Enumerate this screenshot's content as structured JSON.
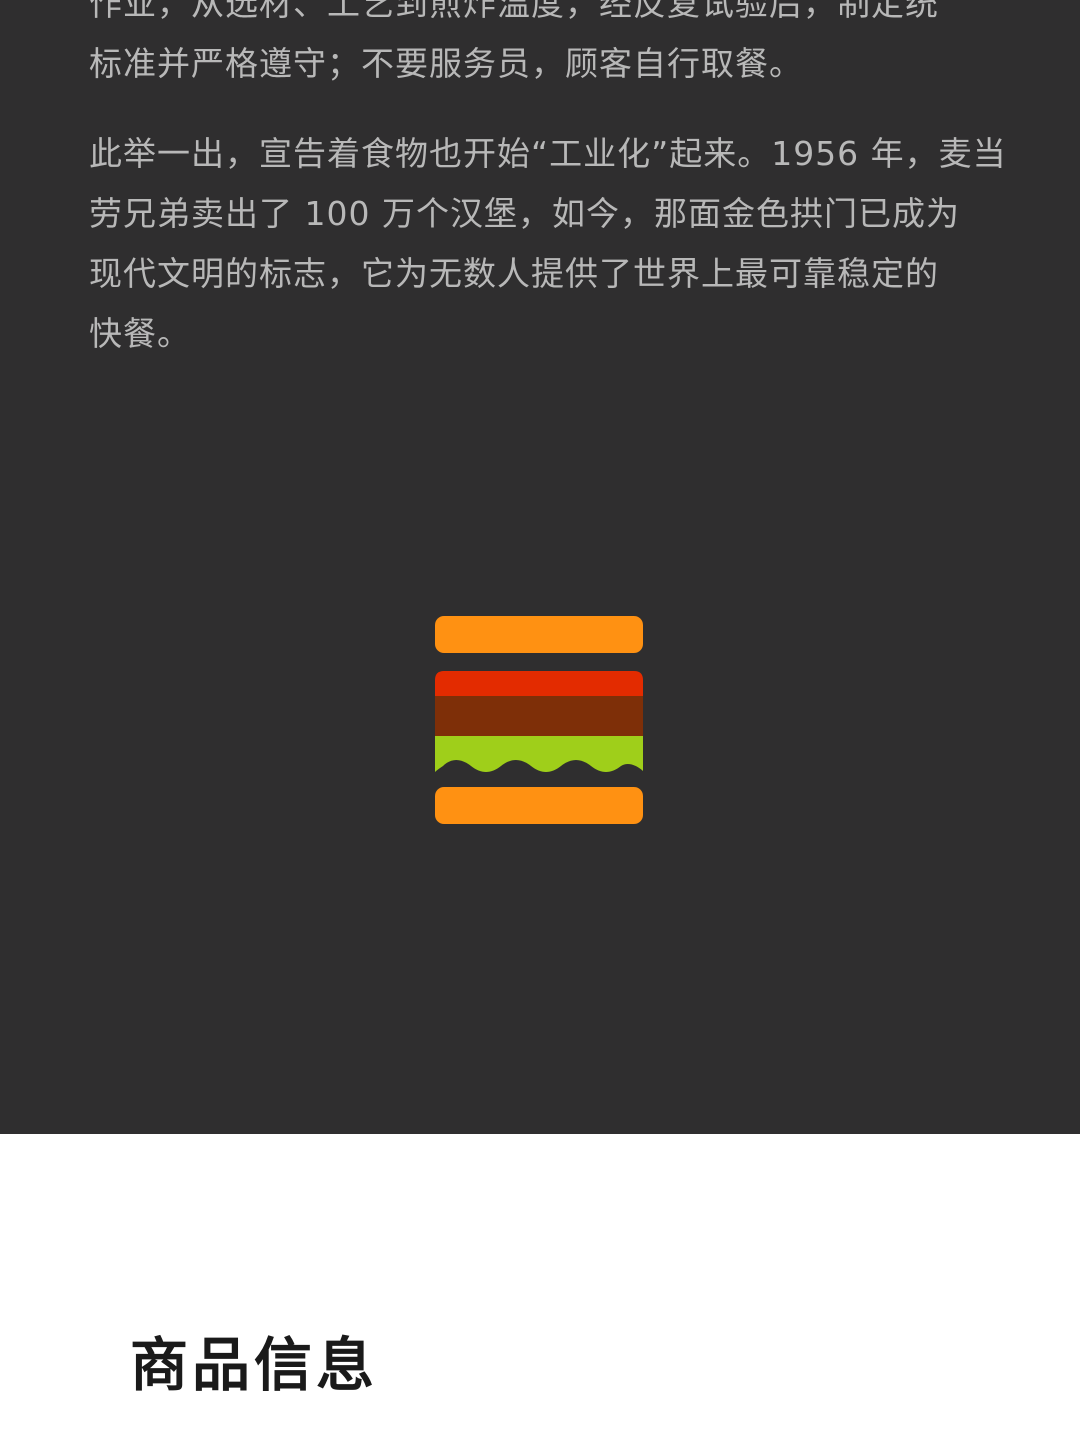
{
  "article": {
    "paragraph1": {
      "line1": "作业，从选材、工艺到煎炸温度，经反复试验后，制定统",
      "line2": "标准并严格遵守；不要服务员，顾客自行取餐。"
    },
    "paragraph2": {
      "line1": "此举一出，宣告着食物也开始“工业化”起来。1956 年，麦当",
      "line2": "劳兄弟卖出了  100  万个汉堡，如今，那面金色拱门已成为",
      "line3": "现代文明的标志，它为无数人提供了世界上最可靠稳定的",
      "line4": "快餐。"
    }
  },
  "illustration": {
    "icon": "hamburger-icon",
    "colors": {
      "bun": "#ff9112",
      "tomato": "#e32b00",
      "patty": "#7e2f08",
      "lettuce": "#9fcf1a"
    }
  },
  "product_section": {
    "title": "商品信息"
  },
  "theme": {
    "dark_background": "#2f2e2f",
    "body_text": "#b8b8b8",
    "light_background": "#ffffff",
    "title_text": "#1a1a1a"
  }
}
